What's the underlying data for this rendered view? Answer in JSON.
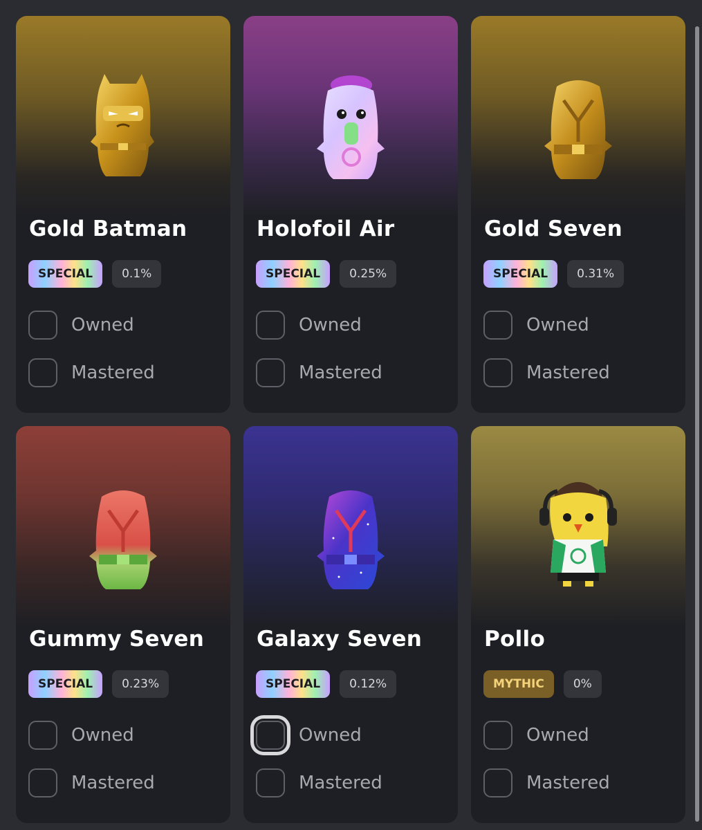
{
  "cards": [
    {
      "name": "Gold Batman",
      "rarity": "SPECIAL",
      "percent": "0.1%",
      "owned_label": "Owned",
      "mastered_label": "Mastered"
    },
    {
      "name": "Holofoil Air",
      "rarity": "SPECIAL",
      "percent": "0.25%",
      "owned_label": "Owned",
      "mastered_label": "Mastered"
    },
    {
      "name": "Gold Seven",
      "rarity": "SPECIAL",
      "percent": "0.31%",
      "owned_label": "Owned",
      "mastered_label": "Mastered"
    },
    {
      "name": "Gummy Seven",
      "rarity": "SPECIAL",
      "percent": "0.23%",
      "owned_label": "Owned",
      "mastered_label": "Mastered"
    },
    {
      "name": "Galaxy Seven",
      "rarity": "SPECIAL",
      "percent": "0.12%",
      "owned_label": "Owned",
      "mastered_label": "Mastered"
    },
    {
      "name": "Pollo",
      "rarity": "MYTHIC",
      "percent": "0%",
      "owned_label": "Owned",
      "mastered_label": "Mastered"
    }
  ],
  "colors": {
    "page_background": "#2b2c31",
    "card_background": "#1e1f24",
    "mythic_badge": "#7a6026",
    "mythic_text": "#f3d27a"
  }
}
